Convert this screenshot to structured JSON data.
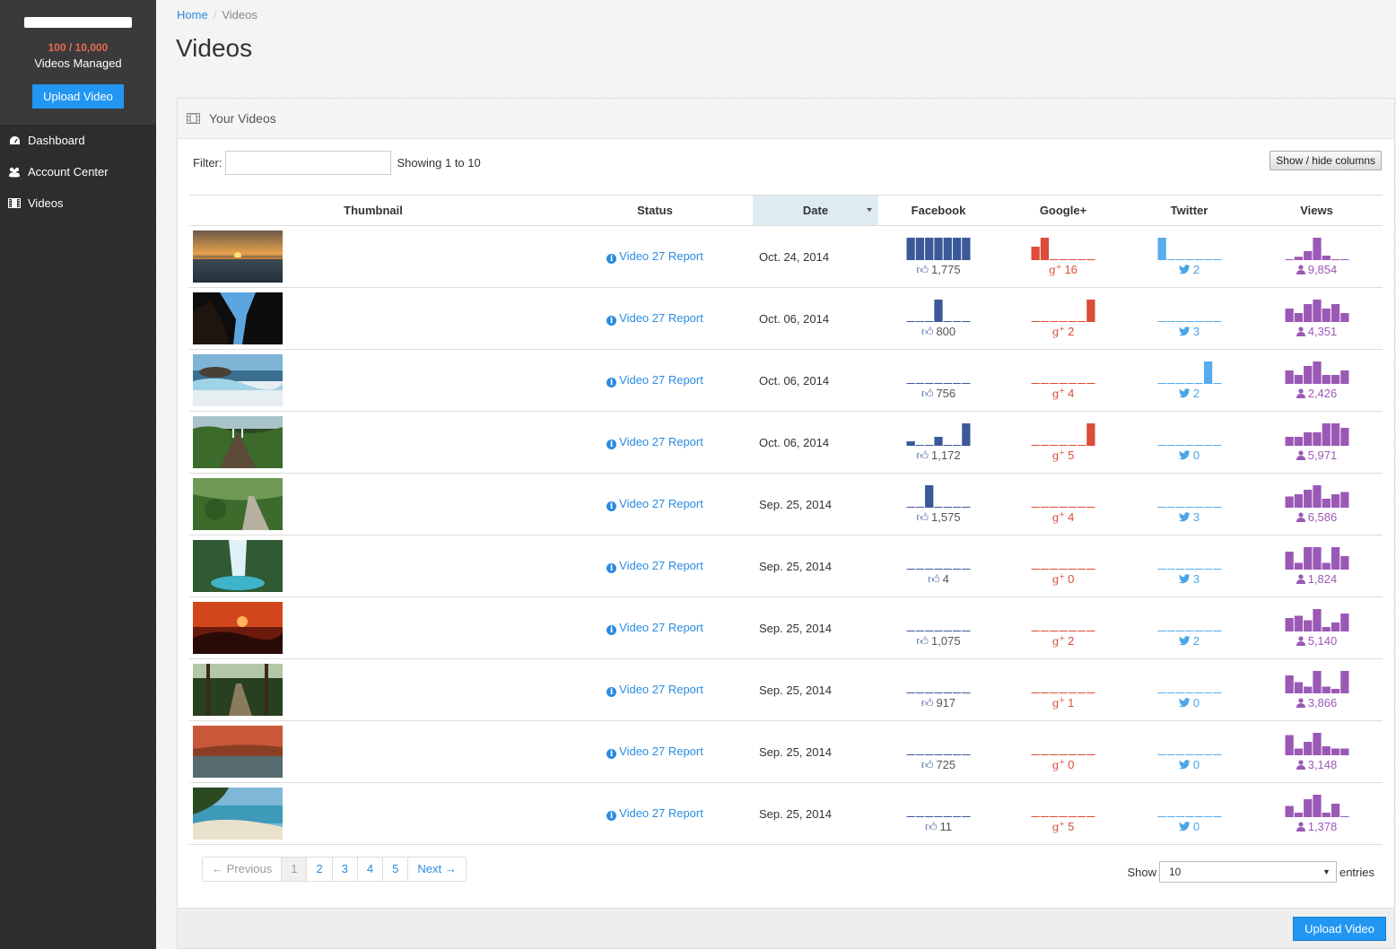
{
  "sidebar": {
    "quota": "100 / 10,000",
    "quota_label": "Videos Managed",
    "upload_label": "Upload Video",
    "items": [
      {
        "label": "Dashboard",
        "icon": "dashboard-icon"
      },
      {
        "label": "Account Center",
        "icon": "users-icon"
      },
      {
        "label": "Videos",
        "icon": "film-icon"
      }
    ]
  },
  "breadcrumb": {
    "home": "Home",
    "current": "Videos"
  },
  "page_title": "Videos",
  "panel": {
    "title": "Your Videos",
    "filter_label": "Filter:",
    "filter_value": "",
    "showing": "Showing 1 to 10",
    "show_hide_label": "Show / hide columns",
    "columns": [
      "Thumbnail",
      "Status",
      "Date",
      "Facebook",
      "Google+",
      "Twitter",
      "Views"
    ],
    "sorted_column": "Date",
    "colors": {
      "facebook": "#3b5998",
      "google": "#dd4b39",
      "twitter": "#55acee",
      "views": "#9b59b6"
    },
    "rows": [
      {
        "thumb": "sunset-sea",
        "status": "Video 27 Report",
        "date": "Oct. 24, 2014",
        "facebook": "1,775",
        "google": "16",
        "twitter": "2",
        "views": "9,854",
        "fb_spark": [
          1,
          1,
          1,
          1,
          1,
          1,
          1
        ],
        "gp_spark": [
          0.6,
          1,
          0,
          0,
          0,
          0,
          0
        ],
        "tw_spark": [
          1,
          0,
          0,
          0,
          0,
          0,
          0
        ],
        "vw_spark": [
          0,
          0.15,
          0.4,
          1,
          0.2,
          0,
          0
        ]
      },
      {
        "thumb": "cave-sky",
        "status": "Video 27 Report",
        "date": "Oct. 06, 2014",
        "facebook": "800",
        "google": "2",
        "twitter": "3",
        "views": "4,351",
        "fb_spark": [
          0,
          0,
          0,
          1,
          0,
          0,
          0
        ],
        "gp_spark": [
          0,
          0,
          0,
          0,
          0,
          0,
          1
        ],
        "tw_spark": [
          0,
          0,
          0,
          0,
          0,
          0,
          0
        ],
        "vw_spark": [
          0.6,
          0.4,
          0.8,
          1,
          0.6,
          0.8,
          0.4
        ]
      },
      {
        "thumb": "rocky-beach",
        "status": "Video 27 Report",
        "date": "Oct. 06, 2014",
        "facebook": "756",
        "google": "4",
        "twitter": "2",
        "views": "2,426",
        "fb_spark": [
          0,
          0,
          0,
          0,
          0,
          0,
          0
        ],
        "gp_spark": [
          0,
          0,
          0,
          0,
          0,
          0,
          0
        ],
        "tw_spark": [
          0,
          0,
          0,
          0,
          0,
          1,
          0
        ],
        "vw_spark": [
          0.6,
          0.4,
          0.8,
          1,
          0.4,
          0.4,
          0.6
        ]
      },
      {
        "thumb": "forest-bridge",
        "status": "Video 27 Report",
        "date": "Oct. 06, 2014",
        "facebook": "1,172",
        "google": "5",
        "twitter": "0",
        "views": "5,971",
        "fb_spark": [
          0.2,
          0,
          0,
          0.4,
          0,
          0,
          1
        ],
        "gp_spark": [
          0,
          0,
          0,
          0,
          0,
          0,
          1
        ],
        "tw_spark": [
          0,
          0,
          0,
          0,
          0,
          0,
          0
        ],
        "vw_spark": [
          0.4,
          0.4,
          0.6,
          0.6,
          1,
          1,
          0.8
        ]
      },
      {
        "thumb": "garden-path",
        "status": "Video 27 Report",
        "date": "Sep. 25, 2014",
        "facebook": "1,575",
        "google": "4",
        "twitter": "3",
        "views": "6,586",
        "fb_spark": [
          0,
          0,
          1,
          0,
          0,
          0,
          0
        ],
        "gp_spark": [
          0,
          0,
          0,
          0,
          0,
          0,
          0
        ],
        "tw_spark": [
          0,
          0,
          0,
          0,
          0,
          0,
          0
        ],
        "vw_spark": [
          0.5,
          0.6,
          0.8,
          1,
          0.4,
          0.6,
          0.7
        ]
      },
      {
        "thumb": "waterfall",
        "status": "Video 27 Report",
        "date": "Sep. 25, 2014",
        "facebook": "4",
        "google": "0",
        "twitter": "3",
        "views": "1,824",
        "fb_spark": [
          0,
          0,
          0,
          0,
          0,
          0,
          0
        ],
        "gp_spark": [
          0,
          0,
          0,
          0,
          0,
          0,
          0
        ],
        "tw_spark": [
          0,
          0,
          0,
          0,
          0,
          0,
          0
        ],
        "vw_spark": [
          0.8,
          0.3,
          1,
          1,
          0.3,
          1,
          0.6
        ]
      },
      {
        "thumb": "red-sunset",
        "status": "Video 27 Report",
        "date": "Sep. 25, 2014",
        "facebook": "1,075",
        "google": "2",
        "twitter": "2",
        "views": "5,140",
        "fb_spark": [
          0,
          0,
          0,
          0,
          0,
          0,
          0
        ],
        "gp_spark": [
          0,
          0,
          0,
          0,
          0,
          0,
          0
        ],
        "tw_spark": [
          0,
          0,
          0,
          0,
          0,
          0,
          0
        ],
        "vw_spark": [
          0.6,
          0.7,
          0.5,
          1,
          0.2,
          0.4,
          0.8
        ]
      },
      {
        "thumb": "jungle-trail",
        "status": "Video 27 Report",
        "date": "Sep. 25, 2014",
        "facebook": "917",
        "google": "1",
        "twitter": "0",
        "views": "3,866",
        "fb_spark": [
          0,
          0,
          0,
          0,
          0,
          0,
          0
        ],
        "gp_spark": [
          0,
          0,
          0,
          0,
          0,
          0,
          0
        ],
        "tw_spark": [
          0,
          0,
          0,
          0,
          0,
          0,
          0
        ],
        "vw_spark": [
          0.8,
          0.5,
          0.3,
          1,
          0.3,
          0.2,
          1
        ]
      },
      {
        "thumb": "autumn-lake",
        "status": "Video 27 Report",
        "date": "Sep. 25, 2014",
        "facebook": "725",
        "google": "0",
        "twitter": "0",
        "views": "3,148",
        "fb_spark": [
          0,
          0,
          0,
          0,
          0,
          0,
          0
        ],
        "gp_spark": [
          0,
          0,
          0,
          0,
          0,
          0,
          0
        ],
        "tw_spark": [
          0,
          0,
          0,
          0,
          0,
          0,
          0
        ],
        "vw_spark": [
          0.9,
          0.3,
          0.6,
          1,
          0.4,
          0.3,
          0.3
        ]
      },
      {
        "thumb": "tropical-beach",
        "status": "Video 27 Report",
        "date": "Sep. 25, 2014",
        "facebook": "11",
        "google": "5",
        "twitter": "0",
        "views": "1,378",
        "fb_spark": [
          0,
          0,
          0,
          0,
          0,
          0,
          0
        ],
        "gp_spark": [
          0,
          0,
          0,
          0,
          0,
          0,
          0
        ],
        "tw_spark": [
          0,
          0,
          0,
          0,
          0,
          0,
          0
        ],
        "vw_spark": [
          0.5,
          0.2,
          0.8,
          1,
          0.2,
          0.6,
          0
        ]
      }
    ]
  },
  "pagination": {
    "prev": "← Previous",
    "pages": [
      "1",
      "2",
      "3",
      "4",
      "5"
    ],
    "active": "1",
    "next": "Next →"
  },
  "length": {
    "show_label": "Show",
    "value": "10",
    "entries_label": "entries"
  },
  "footer": {
    "upload_label": "Upload Video"
  }
}
